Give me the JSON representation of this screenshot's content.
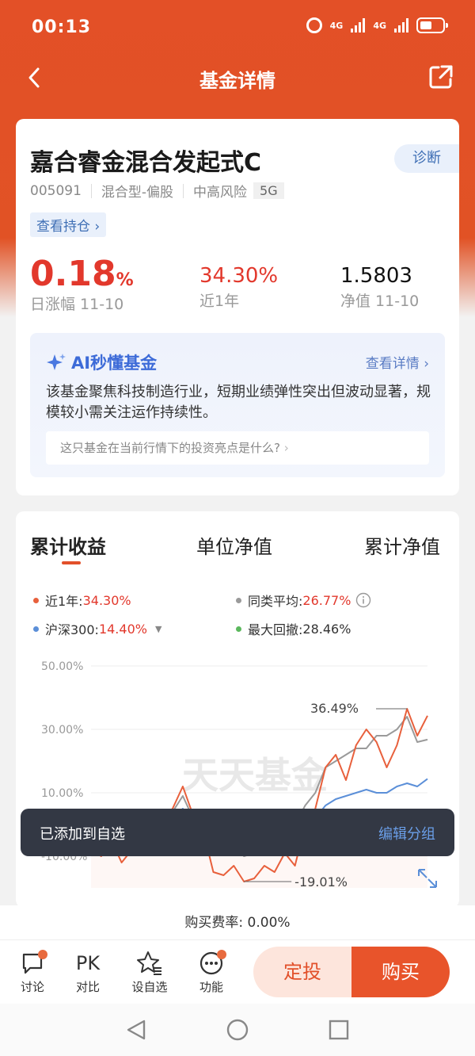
{
  "status_bar": {
    "time": "00:13",
    "network1": "4G",
    "network2": "4G"
  },
  "nav": {
    "title": "基金详情"
  },
  "fund": {
    "name": "嘉合睿金混合发起式C",
    "diagnose": "诊断",
    "code": "005091",
    "type": "混合型-偏股",
    "risk": "中高风险",
    "tag": "5G",
    "holdings_link": "查看持仓",
    "daily_change_value": "0.18",
    "daily_change_unit": "%",
    "daily_change_label": "日涨幅 11-10",
    "one_year_value": "34.30%",
    "one_year_label": "近1年",
    "nav_value": "1.5803",
    "nav_label": "净值 11-10"
  },
  "ai": {
    "title": "AI秒懂基金",
    "detail": "查看详情",
    "summary": "该基金聚焦科技制造行业，短期业绩弹性突出但波动显著，规模较小需关注运作持续性。",
    "question": "这只基金在当前行情下的投资亮点是什么?"
  },
  "chart_tabs": [
    "累计收益",
    "单位净值",
    "累计净值"
  ],
  "legend": {
    "item1_label": "近1年:",
    "item1_value": "34.30%",
    "item2_label": "同类平均:",
    "item2_value": "26.77%",
    "item3_label": "沪深300:",
    "item3_value": "14.40%",
    "item4_label": "最大回撤:",
    "item4_value": "28.46%"
  },
  "colors": {
    "fund": "#e8603c",
    "peer": "#9a9a9a",
    "hs300": "#5b8fd8",
    "drawdown": "#5bb85d",
    "brand": "#e2502a"
  },
  "chart_data": {
    "type": "line",
    "yticks": [
      "50.00%",
      "30.00%",
      "10.00%",
      "-10.00%"
    ],
    "ylim": [
      -20,
      50
    ],
    "annotations": {
      "max": "36.49%",
      "min": "-19.01%"
    },
    "watermark": "天天基金",
    "series": [
      {
        "name": "近1年",
        "values": [
          -8,
          -10,
          -5,
          -12,
          -8,
          -3,
          -6,
          2,
          5,
          12,
          3,
          -2,
          -15,
          -16,
          -13,
          -18,
          -17,
          -13,
          -15,
          -9,
          -13,
          0,
          5,
          18,
          22,
          14,
          25,
          30,
          26,
          18,
          25,
          36.5,
          28,
          34.3
        ]
      },
      {
        "name": "同类平均",
        "values": [
          -6,
          -8,
          -4,
          -9,
          -6,
          -2,
          -4,
          2,
          4,
          9,
          2,
          -1,
          -8,
          -9,
          -7,
          -10,
          -9,
          -6,
          -6,
          -2,
          0,
          6,
          10,
          18,
          20,
          22,
          24,
          24,
          28,
          28,
          30,
          34,
          26,
          26.77
        ]
      },
      {
        "name": "沪深300",
        "values": [
          -5,
          -6,
          -4,
          -6,
          -5,
          -3,
          -4,
          0,
          2,
          5,
          1,
          -2,
          -6,
          -7,
          -6,
          -8,
          -7,
          -5,
          -4,
          -3,
          -2,
          0,
          2,
          6,
          8,
          9,
          10,
          11,
          10,
          10,
          12,
          13,
          12,
          14.4
        ]
      }
    ]
  },
  "toast": {
    "message": "已添加到自选",
    "action": "编辑分组"
  },
  "fee": "购买费率: 0.00%",
  "actions": {
    "discuss": "讨论",
    "compare": "对比",
    "compare_icon": "PK",
    "watch": "设自选",
    "functions": "功能",
    "invest": "定投",
    "buy": "购买"
  }
}
